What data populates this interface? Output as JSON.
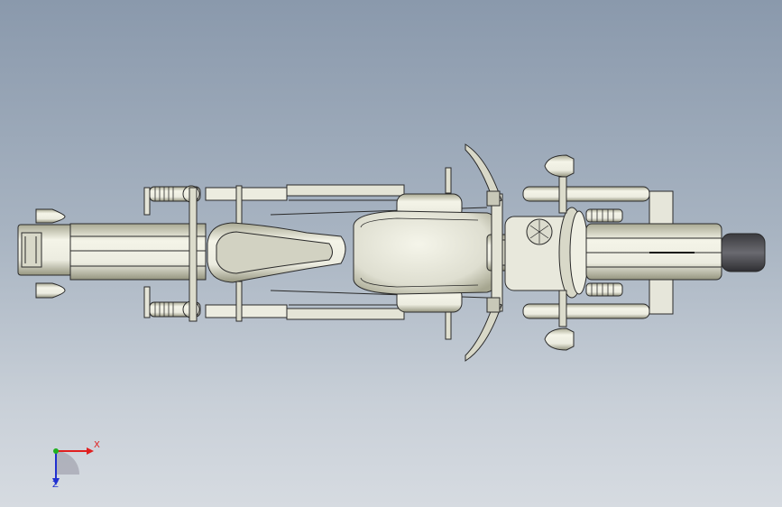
{
  "viewport": {
    "background_top": "#8a99ac",
    "background_bottom": "#d6dbe1"
  },
  "model": {
    "icon": "motorcycle-top-view",
    "body_color": "#e8e8d8",
    "edge_color": "#2a2a2a",
    "shadow_color": "#9c9c86"
  },
  "triad": {
    "x_label": "X",
    "z_label": "Z",
    "x_color": "#e02020",
    "y_color": "#20b020",
    "z_color": "#2030d0"
  }
}
